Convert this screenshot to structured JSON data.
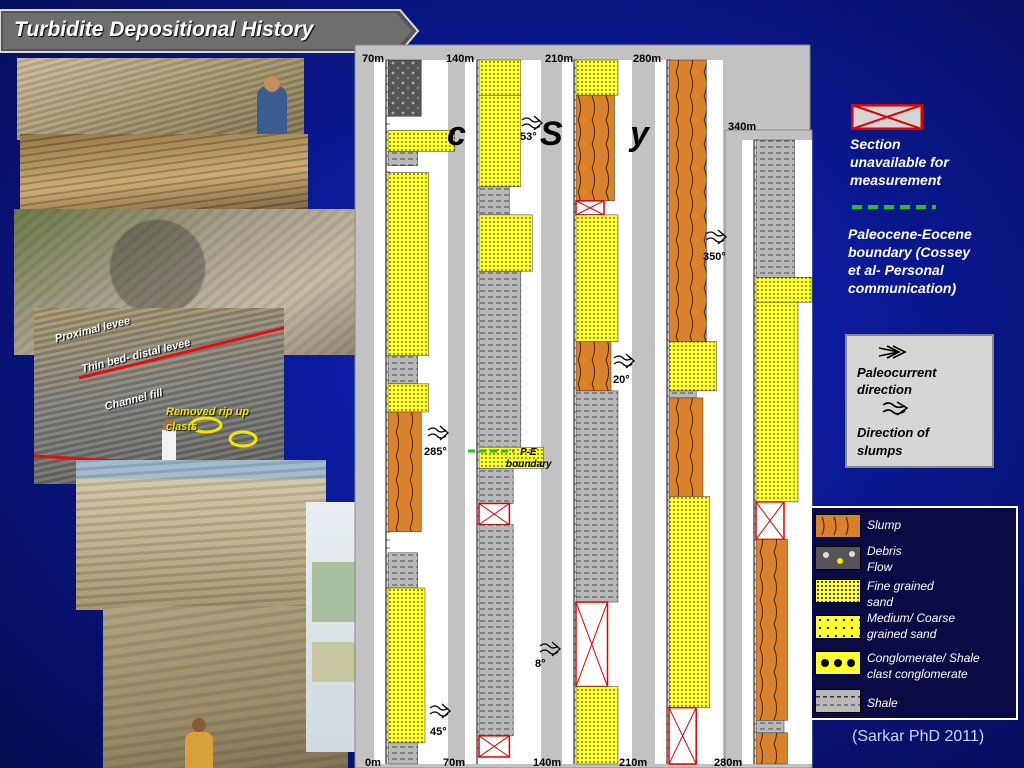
{
  "title": "Turbidite Depositional History",
  "photo_annotations": {
    "proximal_levee": "Proximal levee",
    "thin_bed": "Thin bed- distal levee",
    "channel_fill": "Channel fill",
    "rip_up_line1": "Removed rip up",
    "rip_up_line2": "clasts"
  },
  "section_labels": {
    "top": [
      "70m",
      "140m",
      "210m",
      "280m",
      "340m"
    ],
    "bottom": [
      "0m",
      "70m",
      "140m",
      "210m",
      "280m"
    ]
  },
  "paleocurrent_readings": [
    "53°",
    "350°",
    "20°",
    "285°",
    "8°",
    "45°"
  ],
  "pe_boundary_label_line1": "P-E",
  "pe_boundary_label_line2": "boundary",
  "obscured_title_fragment": "c",
  "obscured_title_fragment2": "S",
  "obscured_title_fragment3": "y",
  "legend": {
    "section_unavailable": [
      "Section",
      "unavailable for",
      "measurement"
    ],
    "pe_boundary": [
      "Paleocene-Eocene",
      "boundary (Cossey",
      "et al- Personal",
      "communication)"
    ]
  },
  "paleo_box": {
    "paleocurrent": [
      "Paleocurrent",
      "direction"
    ],
    "slumps": [
      "Direction of",
      "slumps"
    ]
  },
  "lithology": [
    {
      "label": [
        "Slump"
      ],
      "key": "slump"
    },
    {
      "label": [
        "Debris",
        "Flow"
      ],
      "key": "debris"
    },
    {
      "label": [
        "Fine grained",
        "sand"
      ],
      "key": "fine"
    },
    {
      "label": [
        "Medium/ Coarse",
        "grained sand"
      ],
      "key": "medium"
    },
    {
      "label": [
        "Conglomerate/ Shale",
        "clast conglomerate"
      ],
      "key": "conglomerate"
    },
    {
      "label": [
        "Shale"
      ],
      "key": "shale"
    }
  ],
  "citation": "(Sarkar PhD 2011)",
  "colors": {
    "background": "#0a1890",
    "slump": "#d9822b",
    "sand": "#ffff2a",
    "shale": "#b8b8b8",
    "debris": "#555555",
    "unavailable": "#e00000",
    "pe_boundary": "#21c321"
  }
}
